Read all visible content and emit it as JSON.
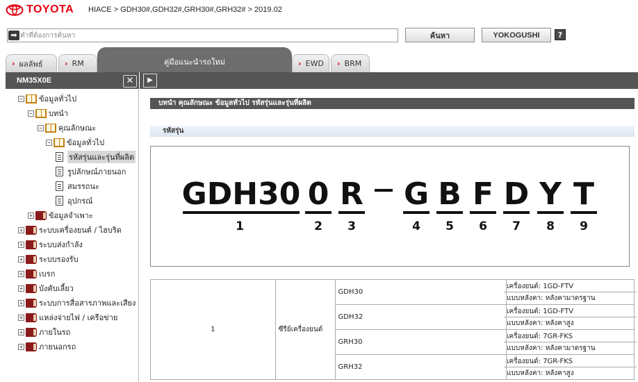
{
  "header": {
    "brand": "TOYOTA",
    "breadcrumb": "HIACE > GDH30#,GDH32#,GRH30#,GRH32# > 2019.02",
    "brand_color": "#e60012"
  },
  "search": {
    "placeholder": "คำที่ต้องการค้นหา",
    "value": "",
    "search_label": "ค้นหา",
    "yokogushi_label": "YOKOGUSHI",
    "help_label": "?"
  },
  "tabs": {
    "items": [
      {
        "label": "ผลลัพธ์"
      },
      {
        "label": "RM"
      },
      {
        "label": "คู่มือแนะนำรถใหม่"
      },
      {
        "label": "EWD"
      },
      {
        "label": "BRM"
      }
    ],
    "active_index": 2
  },
  "left": {
    "title": "NM35X0E",
    "close_label": "✕",
    "tree": [
      {
        "label": "ข้อมูลทั่วไป",
        "level": 0,
        "icon": "open-book-icon",
        "toggle": "−"
      },
      {
        "label": "บทนำ",
        "level": 1,
        "icon": "open-book-icon",
        "toggle": "−"
      },
      {
        "label": "คุณลักษณะ",
        "level": 2,
        "icon": "open-book-icon",
        "toggle": "−"
      },
      {
        "label": "ข้อมูลทั่วไป",
        "level": 3,
        "icon": "open-book-icon",
        "toggle": "−"
      },
      {
        "label": "รหัสรุ่นและรุ่นที่ผลิต",
        "level": 4,
        "icon": "page-icon",
        "toggle": "",
        "selected": true
      },
      {
        "label": "รูปลักษณ์ภายนอก",
        "level": 4,
        "icon": "page-icon",
        "toggle": ""
      },
      {
        "label": "สมรรถนะ",
        "level": 4,
        "icon": "page-icon",
        "toggle": ""
      },
      {
        "label": "อุปกรณ์",
        "level": 4,
        "icon": "page-icon",
        "toggle": ""
      },
      {
        "label": "ข้อมูลจำเพาะ",
        "level": 1,
        "icon": "closed-book-icon",
        "toggle": "+"
      },
      {
        "label": "ระบบเครื่องยนต์ / ไฮบริด",
        "level": 0,
        "icon": "closed-book-icon",
        "toggle": "+"
      },
      {
        "label": "ระบบส่งกำลัง",
        "level": 0,
        "icon": "closed-book-icon",
        "toggle": "+"
      },
      {
        "label": "ระบบรองรับ",
        "level": 0,
        "icon": "closed-book-icon",
        "toggle": "+"
      },
      {
        "label": "เบรก",
        "level": 0,
        "icon": "closed-book-icon",
        "toggle": "+"
      },
      {
        "label": "บังคับเลี้ยว",
        "level": 0,
        "icon": "closed-book-icon",
        "toggle": "+"
      },
      {
        "label": "ระบบการสื่อสารภาพและเสียง /",
        "level": 0,
        "icon": "closed-book-icon",
        "toggle": "+"
      },
      {
        "label": "แหล่งจ่ายไฟ / เครือข่าย",
        "level": 0,
        "icon": "closed-book-icon",
        "toggle": "+"
      },
      {
        "label": "ภายในรถ",
        "level": 0,
        "icon": "closed-book-icon",
        "toggle": "+"
      },
      {
        "label": "ภายนอกรถ",
        "level": 0,
        "icon": "closed-book-icon",
        "toggle": "+"
      }
    ]
  },
  "content": {
    "title": "บทนำ  คุณลักษณะ  ข้อมูลทั่วไป  รหัสรุ่นและรุ่นที่ผลิต",
    "section": "รหัสรุ่น",
    "code_segments": [
      "GDH30",
      "0",
      "R",
      "G",
      "B",
      "F",
      "D",
      "Y",
      "T"
    ],
    "code_numbers": [
      "1",
      "2",
      "3",
      "4",
      "5",
      "6",
      "7",
      "8",
      "9"
    ],
    "table": {
      "row_num": "1",
      "row_label": "ซีรีย์เครื่องยนต์",
      "models": [
        {
          "code": "GDH30",
          "engine": "เครื่องยนต์: 1GD-FTV",
          "roof": "แบบหลังคา: หลังคามาตรฐาน"
        },
        {
          "code": "GDH32",
          "engine": "เครื่องยนต์: 1GD-FTV",
          "roof": "แบบหลังคา: หลังคาสูง"
        },
        {
          "code": "GRH30",
          "engine": "เครื่องยนต์: 7GR-FKS",
          "roof": "แบบหลังคา: หลังคามาตรฐาน"
        },
        {
          "code": "GRH32",
          "engine": "เครื่องยนต์: 7GR-FKS",
          "roof": "แบบหลังคา: หลังคาสูง"
        }
      ]
    }
  }
}
